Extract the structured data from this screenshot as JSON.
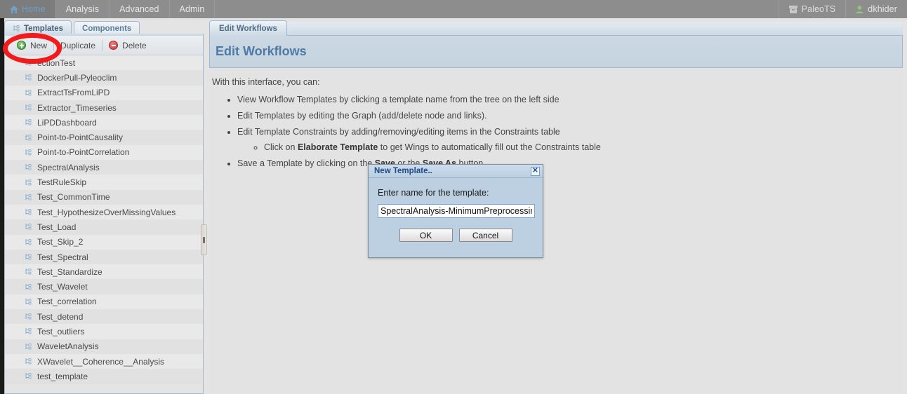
{
  "topnav": {
    "left_items": [
      {
        "label": "Home",
        "icon": "home-icon",
        "active": true
      },
      {
        "label": "Analysis",
        "icon": "",
        "active": false
      },
      {
        "label": "Advanced",
        "icon": "",
        "active": false
      },
      {
        "label": "Admin",
        "icon": "",
        "active": false
      }
    ],
    "right_items": [
      {
        "label": "PaleoTS",
        "icon": "box-icon"
      },
      {
        "label": "dkhider",
        "icon": "user-icon"
      }
    ]
  },
  "left_panel": {
    "tabs": [
      {
        "label": "Templates",
        "active": true,
        "icon": "tree-icon"
      },
      {
        "label": "Components",
        "active": false,
        "icon": ""
      }
    ],
    "toolbar": {
      "new_label": "New",
      "duplicate_label": "Duplicate",
      "delete_label": "Delete"
    },
    "tree_items": [
      "ectionTest",
      "DockerPull-Pyleoclim",
      "ExtractTsFromLiPD",
      "Extractor_Timeseries",
      "LiPDDashboard",
      "Point-to-PointCausality",
      "Point-to-PointCorrelation",
      "SpectralAnalysis",
      "TestRuleSkip",
      "Test_CommonTime",
      "Test_HypothesizeOverMissingValues",
      "Test_Load",
      "Test_Skip_2",
      "Test_Spectral",
      "Test_Standardize",
      "Test_Wavelet",
      "Test_correlation",
      "Test_detend",
      "Test_outliers",
      "WaveletAnalysis",
      "XWavelet__Coherence__Analysis",
      "test_template"
    ]
  },
  "main": {
    "tabs": [
      {
        "label": "Edit Workflows",
        "active": true
      }
    ],
    "title": "Edit Workflows",
    "intro": "With this interface, you can:",
    "bullets": [
      {
        "text": "View Workflow Templates by clicking a template name from the tree on the left side"
      },
      {
        "text": "Edit Templates by editing the Graph (add/delete node and links)."
      },
      {
        "text": "Edit Template Constraints by adding/removing/editing items in the Constraints table",
        "sub": [
          {
            "pre": "Click on ",
            "bold": "Elaborate Template",
            "post": " to get Wings to automatically fill out the Constraints table"
          }
        ]
      },
      {
        "pre": "Save a Template by clicking on the ",
        "bold": "Save",
        "mid": " or the ",
        "bold2": "Save As",
        "post": " button"
      }
    ]
  },
  "dialog": {
    "title": "New Template..",
    "close_label": "✕",
    "prompt": "Enter name for the template:",
    "input_value": "SpectralAnalysis-MinimumPreprocessing",
    "input_placeholder": "",
    "ok_label": "OK",
    "cancel_label": "Cancel"
  },
  "annotation": {
    "shape": "red-ellipse",
    "color": "#f21b1b",
    "targets": "new-button"
  },
  "colors": {
    "topbar": "#8d8d8d",
    "nav_active_text": "#6fa0c6",
    "panel_bg": "#e3e3e3",
    "tab_border": "#a3b8cc",
    "title_blue": "#4e7ba6",
    "dialog_bg": "#bcd0e2",
    "annotation_red": "#f21b1b"
  }
}
